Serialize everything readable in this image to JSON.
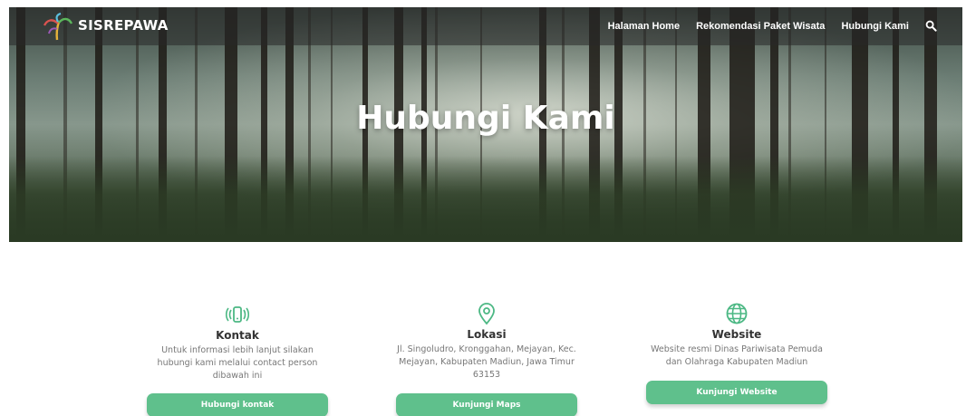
{
  "header": {
    "brand": "SISREPAWA",
    "logo_icon": "flame-logo-icon",
    "nav": [
      "Halaman Home",
      "Rekomendasi Paket Wisata",
      "Hubungi Kami"
    ],
    "search_icon": "search-icon"
  },
  "hero": {
    "title": "Hubungi Kami"
  },
  "cards": [
    {
      "icon": "phone-vibrate-icon",
      "title": "Kontak",
      "text": "Untuk informasi lebih lanjut silakan hubungi kami melalui contact person dibawah ini",
      "button": "Hubungi kontak"
    },
    {
      "icon": "location-pin-icon",
      "title": "Lokasi",
      "text": "Jl. Singoludro, Kronggahan, Mejayan, Kec. Mejayan, Kabupaten Madiun, Jawa Timur 63153",
      "button": "Kunjungi Maps"
    },
    {
      "icon": "globe-icon",
      "title": "Website",
      "text": "Website resmi Dinas Pariwisata Pemuda dan Olahraga Kabupaten Madiun",
      "button": "Kunjungi Website"
    }
  ],
  "colors": {
    "accent": "#5fc08c",
    "icon": "#4cb884"
  }
}
